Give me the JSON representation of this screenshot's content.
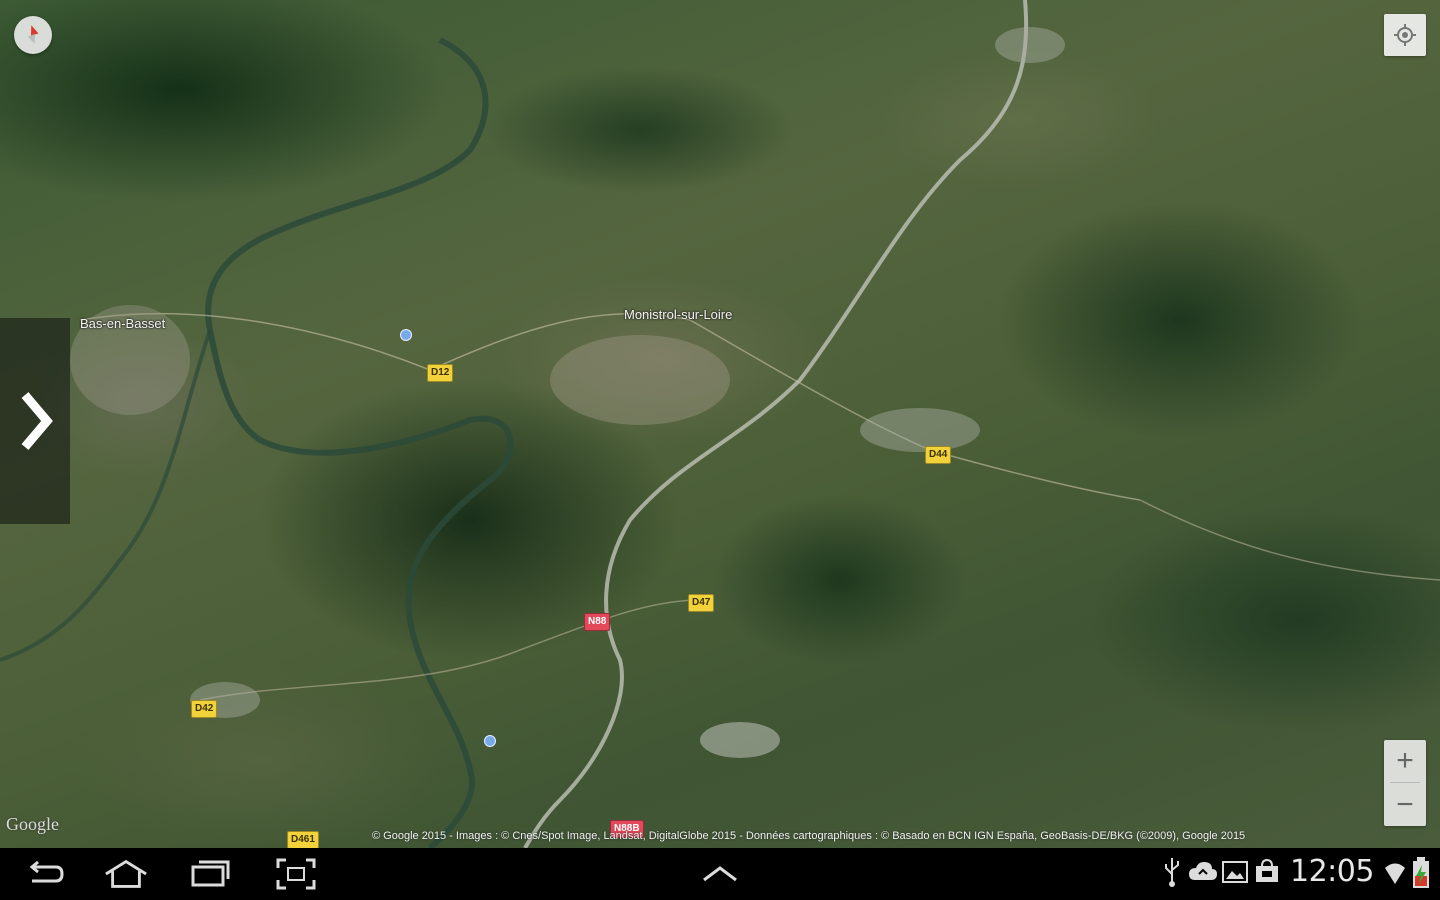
{
  "map": {
    "view": "satellite-3d",
    "places": [
      {
        "id": "bas-en-basset",
        "label": "Bas-en-Basset"
      },
      {
        "id": "monistrol",
        "label": "Monistrol-sur-Loire"
      }
    ],
    "road_shields": [
      {
        "id": "d12",
        "label": "D12",
        "kind": "departmental",
        "color": "#f2d23a"
      },
      {
        "id": "d44",
        "label": "D44",
        "kind": "departmental",
        "color": "#f2d23a"
      },
      {
        "id": "d47",
        "label": "D47",
        "kind": "departmental",
        "color": "#f2d23a"
      },
      {
        "id": "n88",
        "label": "N88",
        "kind": "national",
        "color": "#e3495a"
      },
      {
        "id": "d42",
        "label": "D42",
        "kind": "departmental",
        "color": "#f2d23a"
      },
      {
        "id": "d461",
        "label": "D461",
        "kind": "departmental",
        "color": "#f2d23a"
      },
      {
        "id": "n88b",
        "label": "N88B",
        "kind": "national",
        "color": "#e3495a"
      }
    ],
    "google_logo": "Google",
    "attribution": "© Google 2015 - Images : © Cnes/Spot Image, Landsat, DigitalGlobe 2015 - Données cartographiques : © Basado en BCN IGN España, GeoBasis-DE/BKG (©2009), Google 2015"
  },
  "controls": {
    "compass_icon": "compass-icon",
    "locate_icon": "my-location-icon",
    "drawer_icon": "chevron-right-icon",
    "zoom_in": "+",
    "zoom_out": "−"
  },
  "navbar": {
    "back_icon": "back-icon",
    "home_icon": "home-icon",
    "recents_icon": "recent-apps-icon",
    "screenshot_icon": "screenshot-icon",
    "up_icon": "chevron-up-icon"
  },
  "status": {
    "time": "12:05",
    "icons": [
      "usb-icon",
      "cloud-upload-icon",
      "gallery-icon",
      "store-icon",
      "wifi-icon",
      "battery-charging-icon"
    ]
  },
  "colors": {
    "departmental_shield": "#f2d23a",
    "national_shield": "#e3495a",
    "navbar": "#000000"
  }
}
